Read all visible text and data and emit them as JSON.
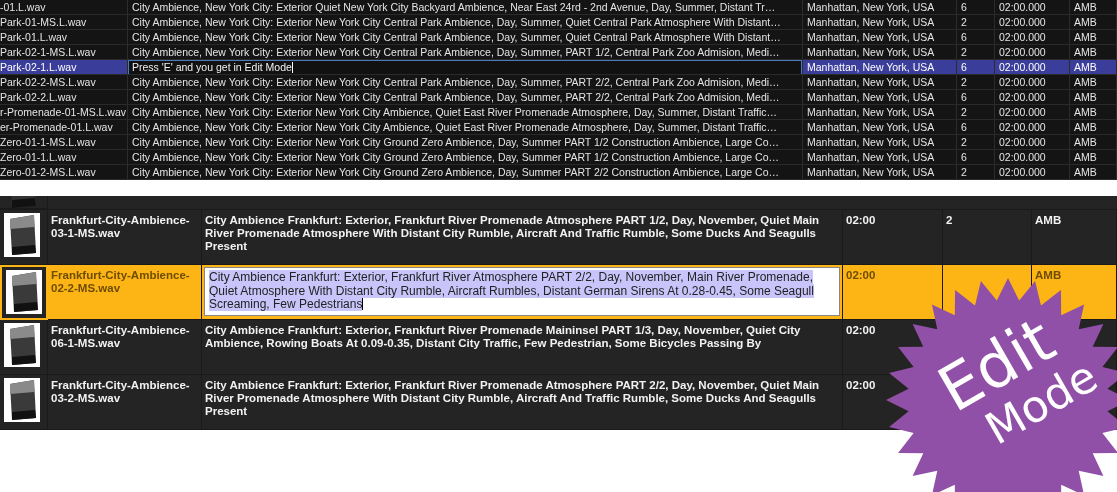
{
  "top_table": {
    "rows": [
      {
        "name": "-01.L.wav",
        "description": "City Ambience, New York City: Exterior Quiet New York City Backyard Ambience, Near East 24rd - 2nd Avenue, Day, Summer, Distant Tr…",
        "location": "Manhattan, New York, USA",
        "channels": "6",
        "duration": "02:00.000",
        "category": "AMB",
        "selected": false,
        "editing": false
      },
      {
        "name": "Park-01-MS.L.wav",
        "description": "City Ambience, New York City: Exterior New York City Central Park Ambience, Day, Summer, Quiet Central Park Atmosphere With Distant…",
        "location": "Manhattan, New York, USA",
        "channels": "2",
        "duration": "02:00.000",
        "category": "AMB",
        "selected": false,
        "editing": false
      },
      {
        "name": "Park-01.L.wav",
        "description": "City Ambience, New York City: Exterior New York City Central Park Ambience, Day, Summer, Quiet Central Park Atmosphere With Distant…",
        "location": "Manhattan, New York, USA",
        "channels": "6",
        "duration": "02:00.000",
        "category": "AMB",
        "selected": false,
        "editing": false
      },
      {
        "name": "Park-02-1-MS.L.wav",
        "description": "City Ambience, New York City: Exterior New York City Central Park Ambience, Day, Summer, PART 1/2, Central Park Zoo Admision, Medi…",
        "location": "Manhattan, New York, USA",
        "channels": "2",
        "duration": "02:00.000",
        "category": "AMB",
        "selected": false,
        "editing": false
      },
      {
        "name": "Park-02-1.L.wav",
        "description": "Press 'E' and you get in Edit Mode",
        "location": "Manhattan, New York, USA",
        "channels": "6",
        "duration": "02:00.000",
        "category": "AMB",
        "selected": true,
        "editing": true
      },
      {
        "name": "Park-02-2-MS.L.wav",
        "description": "City Ambience, New York City: Exterior New York City Central Park Ambience, Day, Summer, PART 2/2, Central Park Zoo Admision, Medi…",
        "location": "Manhattan, New York, USA",
        "channels": "2",
        "duration": "02:00.000",
        "category": "AMB",
        "selected": false,
        "editing": false
      },
      {
        "name": "Park-02-2.L.wav",
        "description": "City Ambience, New York City: Exterior New York City Central Park Ambience, Day, Summer, PART 2/2, Central Park Zoo Admision, Medi…",
        "location": "Manhattan, New York, USA",
        "channels": "6",
        "duration": "02:00.000",
        "category": "AMB",
        "selected": false,
        "editing": false
      },
      {
        "name": "r-Promenade-01-MS.L.wav",
        "description": "City Ambience, New York City: Exterior New York City Ambience, Quiet East River Promenade Atmosphere, Day, Summer, Distant Traffic…",
        "location": "Manhattan, New York, USA",
        "channels": "2",
        "duration": "02:00.000",
        "category": "AMB",
        "selected": false,
        "editing": false
      },
      {
        "name": "er-Promenade-01.L.wav",
        "description": "City Ambience, New York City: Exterior New York City Ambience, Quiet East River Promenade Atmosphere, Day, Summer, Distant Traffic…",
        "location": "Manhattan, New York, USA",
        "channels": "6",
        "duration": "02:00.000",
        "category": "AMB",
        "selected": false,
        "editing": false
      },
      {
        "name": "Zero-01-1-MS.L.wav",
        "description": "City Ambience, New York City: Exterior New York City Ground Zero Ambience, Day, Summer PART 1/2 Construction Ambience, Large Co…",
        "location": "Manhattan, New York, USA",
        "channels": "2",
        "duration": "02:00.000",
        "category": "AMB",
        "selected": false,
        "editing": false
      },
      {
        "name": "Zero-01-1.L.wav",
        "description": "City Ambience, New York City: Exterior New York City Ground Zero Ambience, Day, Summer PART 1/2 Construction Ambience, Large Co…",
        "location": "Manhattan, New York, USA",
        "channels": "6",
        "duration": "02:00.000",
        "category": "AMB",
        "selected": false,
        "editing": false
      },
      {
        "name": "Zero-01-2-MS.L.wav",
        "description": "City Ambience, New York City: Exterior New York City Ground Zero Ambience, Day, Summer PART 2/2 Construction Ambience, Large Co…",
        "location": "Manhattan, New York, USA",
        "channels": "2",
        "duration": "02:00.000",
        "category": "AMB",
        "selected": false,
        "editing": false
      }
    ]
  },
  "bottom_table": {
    "rows": [
      {
        "name": "Frankfurt-City-Ambience-03-1-MS.wav",
        "description": "City Ambience Frankfurt: Exterior, Frankfurt River Promenade Atmosphere PART 1/2, Day, November, Quiet Main River Promenade Atmosphere With Distant City Rumble, Aircraft And Traffic Rumble, Some Ducks And Seagulls Present",
        "duration": "02:00",
        "channels": "2",
        "category": "AMB",
        "selected": false,
        "editing": false
      },
      {
        "name": "Frankfurt-City-Ambience-02-2-MS.wav",
        "description": "City Ambience Frankfurt: Exterior, Frankfurt River Atmosphere PART 2/2, Day, November, Main River Promenade, Quiet Atmosphere With Distant City Rumble, Aircraft Rumbles, Distant German Sirens At 0.28-0.45, Some Seagull Screaming, Few Pedestrians",
        "duration": "02:00",
        "category": "AMB",
        "selected": true,
        "editing": true
      },
      {
        "name": "Frankfurt-City-Ambience-06-1-MS.wav",
        "description": "City Ambience Frankfurt: Exterior, Frankfurt River Promenade Maininsel PART 1/3, Day, November, Quiet City Ambience, Rowing Boats At 0.09-0.35, Distant City Traffic, Few Pedestrian, Some Bicycles Passing By",
        "duration": "02:00",
        "selected": false,
        "editing": false
      },
      {
        "name": "Frankfurt-City-Ambience-03-2-MS.wav",
        "description": "City Ambience Frankfurt: Exterior, Frankfurt River Promenade Atmosphere PART 2/2, Day, November, Quiet Main River Promenade Atmosphere With Distant City Rumble, Aircraft And Traffic Rumble, Some Ducks And Seagulls Present",
        "duration": "02:00",
        "selected": false,
        "editing": false
      }
    ]
  },
  "badge": {
    "lines": [
      "Edit",
      "Mode"
    ]
  }
}
